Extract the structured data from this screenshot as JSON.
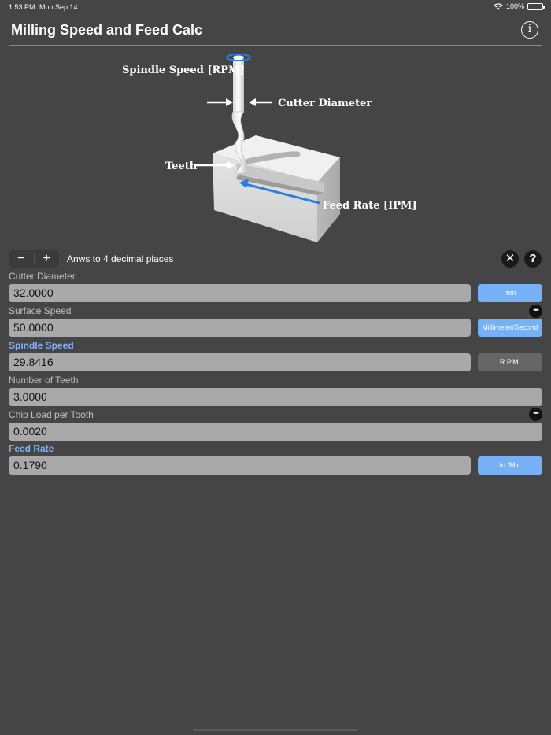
{
  "status": {
    "time": "1:53 PM",
    "date": "Mon Sep 14",
    "battery": "100%"
  },
  "app": {
    "title": "Milling Speed and Feed Calc",
    "info_icon": "i"
  },
  "diagram": {
    "spindle_label": "Spindle Speed [RPM]",
    "cutter_label": "Cutter Diameter",
    "teeth_label": "Teeth",
    "feed_label": "Feed Rate [IPM]"
  },
  "controls": {
    "minus": "−",
    "plus": "+",
    "decimals_text": "Anws to 4 decimal places",
    "clear_icon": "✕",
    "help_icon": "?"
  },
  "more_icon": "•••",
  "fields": {
    "cutter_diameter": {
      "label": "Cutter Diameter",
      "value": "32.0000",
      "unit": "mm"
    },
    "surface_speed": {
      "label": "Surface Speed",
      "value": "50.0000",
      "unit": "Millimeter/Second"
    },
    "spindle_speed": {
      "label": "Spindle Speed",
      "value": "29.8416",
      "unit": "R.P.M."
    },
    "number_of_teeth": {
      "label": "Number of Teeth",
      "value": "3.0000"
    },
    "chip_load": {
      "label": "Chip Load per Tooth",
      "value": "0.0020"
    },
    "feed_rate": {
      "label": "Feed Rate",
      "value": "0.1790",
      "unit": "In./Min"
    }
  },
  "colors": {
    "background": "#454545",
    "accent": "#76b0f5",
    "field": "#a9a9a9",
    "label_accent": "#7fb3f7"
  }
}
